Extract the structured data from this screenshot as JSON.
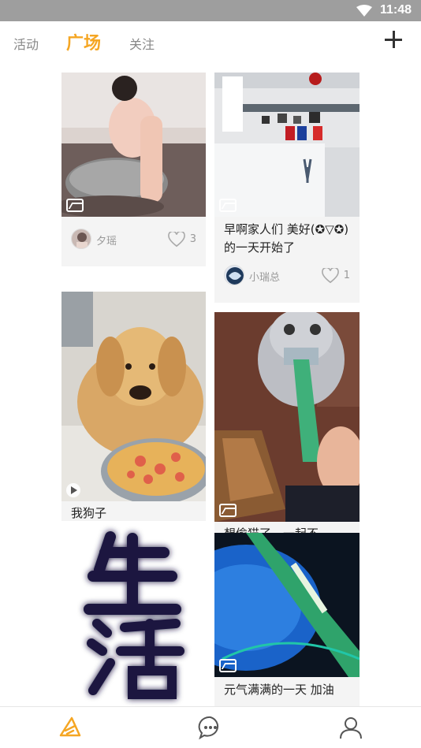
{
  "status": {
    "time": "11:48"
  },
  "nav": {
    "tabs": [
      {
        "label": "活动",
        "active": false
      },
      {
        "label": "广场",
        "active": true
      },
      {
        "label": "关注",
        "active": false
      }
    ],
    "accent": "#f5a623"
  },
  "feed": {
    "cards": [
      {
        "caption": "",
        "user": "夕瑶",
        "likes": "3",
        "media": "image"
      },
      {
        "caption": "早啊家人们 美好(✪▽✪)的一天开始了",
        "user": "小瑞总",
        "likes": "1",
        "media": "image"
      },
      {
        "caption": "我狗子",
        "media": "video"
      },
      {
        "caption": "想偷猫了，一起不",
        "media": "image"
      },
      {
        "caption": "",
        "image_text": "生活",
        "media": "image"
      },
      {
        "caption": "元气满满的一天 加油",
        "media": "image"
      }
    ]
  },
  "bottom": {
    "icons": [
      "home-icon",
      "chat-icon",
      "profile-icon"
    ],
    "active": "home-icon"
  }
}
